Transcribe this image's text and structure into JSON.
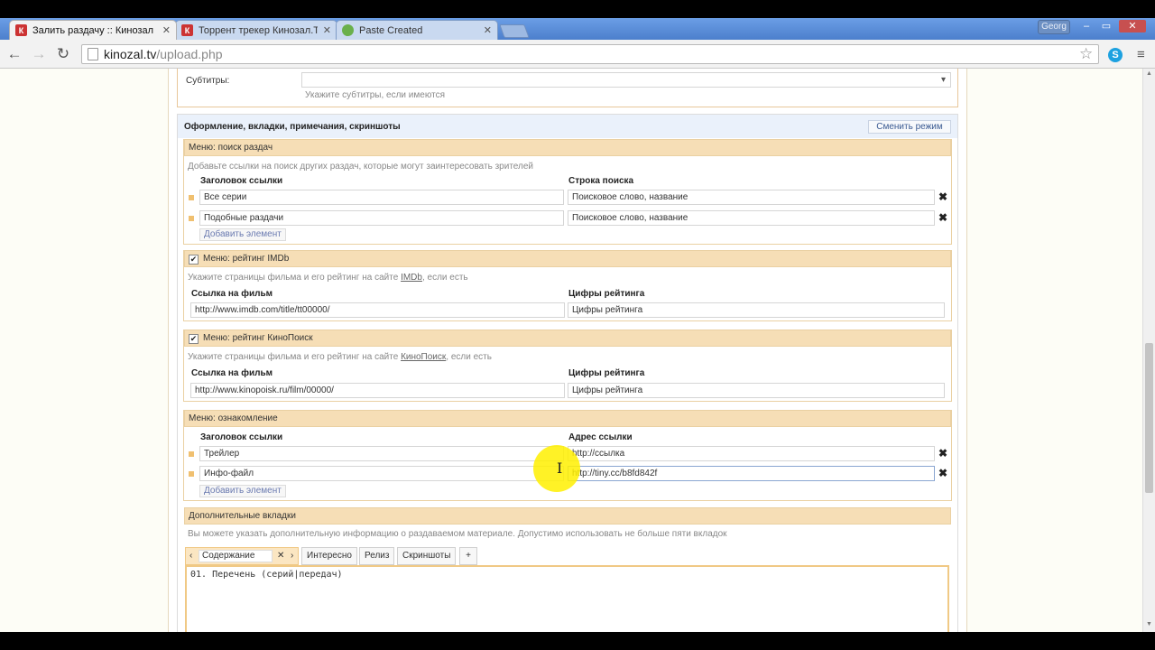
{
  "browser": {
    "tabs": [
      {
        "title": "Залить раздачу :: Кинозал",
        "favicon": "К",
        "favicon_color": "#c33",
        "close": "✕"
      },
      {
        "title": "Торрент трекер Кинозал.Т",
        "favicon": "К",
        "favicon_color": "#c33",
        "close": "✕"
      },
      {
        "title": "Paste Created",
        "favicon": "",
        "favicon_color": "#6ab04c",
        "close": "✕"
      }
    ],
    "profile": "Georg",
    "window_buttons": [
      "–",
      "▭",
      "✕"
    ],
    "url_host": "kinozal.tv",
    "url_path": "/upload.php",
    "icons": {
      "back": "←",
      "forward": "→",
      "reload": "↻",
      "star": "☆",
      "skype": "S",
      "menu": "≡"
    }
  },
  "subtitles": {
    "label": "Субтитры:",
    "hint": "Укажите субтитры, если имеются",
    "arrow": "▾"
  },
  "design": {
    "header": "Оформление, вкладки, примечания, скриншоты",
    "mode_button": "Сменить режим"
  },
  "search_menu": {
    "title": "Меню: поиск раздач",
    "hint": "Добавьте ссылки на поиск других раздач, которые могут заинтересовать зрителей",
    "col1": "Заголовок ссылки",
    "col2": "Строка поиска",
    "rows": [
      {
        "title": "Все серии",
        "query": "Поисковое слово, название"
      },
      {
        "title": "Подобные раздачи",
        "query": "Поисковое слово, название"
      }
    ],
    "add": "Добавить элемент",
    "remove": "✖"
  },
  "imdb": {
    "title": "Меню: рейтинг IMDb",
    "checked": "✔",
    "hint_pre": "Укажите страницы фильма и его рейтинг на сайте ",
    "hint_link": "IMDb",
    "hint_post": ", если есть",
    "col1": "Ссылка на фильм",
    "col2": "Цифры рейтинга",
    "url": "http://www.imdb.com/title/tt00000/",
    "rating": "Цифры рейтинга"
  },
  "kinopoisk": {
    "title": "Меню: рейтинг КиноПоиск",
    "checked": "✔",
    "hint_pre": "Укажите страницы фильма и его рейтинг на сайте ",
    "hint_link": "КиноПоиск",
    "hint_post": ", если есть",
    "col1": "Ссылка на фильм",
    "col2": "Цифры рейтинга",
    "url": "http://www.kinopoisk.ru/film/00000/",
    "rating": "Цифры рейтинга"
  },
  "intro_menu": {
    "title": "Меню: ознакомление",
    "col1": "Заголовок ссылки",
    "col2": "Адрес ссылки",
    "rows": [
      {
        "title": "Трейлер",
        "url": "http://ссылка"
      },
      {
        "title": "Инфо-файл",
        "url": "http://tiny.cc/b8fd842f"
      }
    ],
    "add": "Добавить элемент",
    "remove": "✖"
  },
  "extra_tabs": {
    "title": "Дополнительные вкладки",
    "hint": "Вы можете указать дополнительную информацию о раздаваемом материале. Допустимо использовать не больше пяти вкладок",
    "tabs": [
      "Содержание",
      "Интересно",
      "Релиз",
      "Скриншоты"
    ],
    "left": "‹",
    "right": "›",
    "close": "✕",
    "add": "+",
    "editor_text": "01. Перечень (серий|передач)"
  }
}
